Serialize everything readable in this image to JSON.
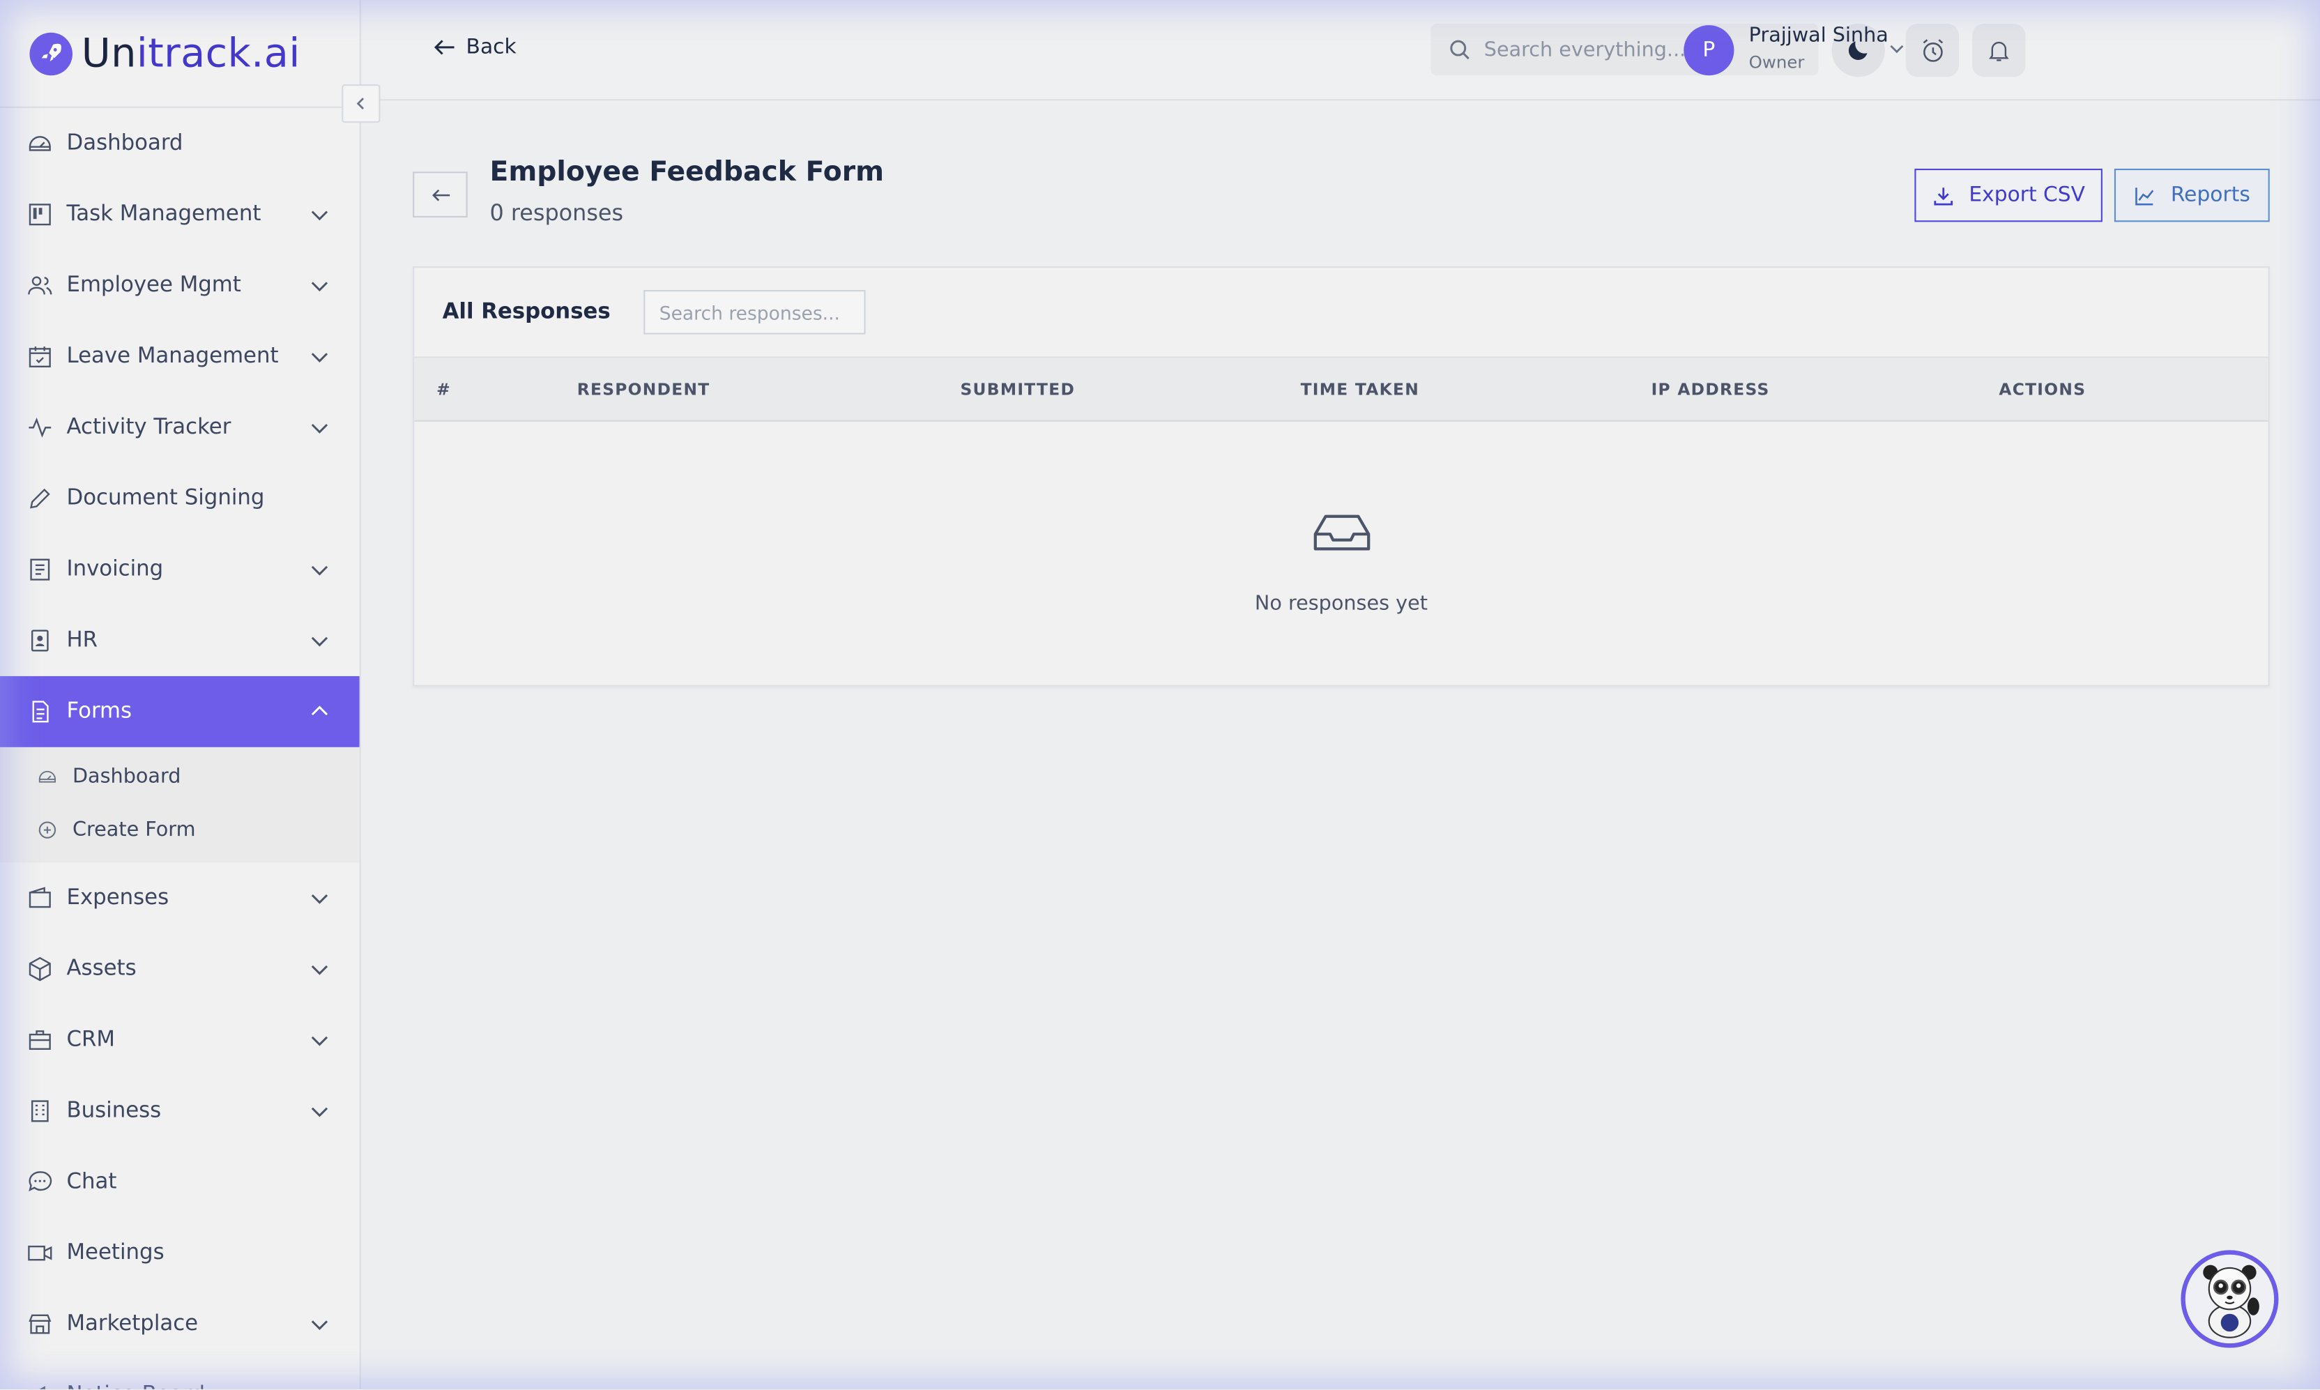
{
  "brand": {
    "logo_u": "Un",
    "logo_rest": "itrack.ai"
  },
  "sidebar": {
    "items": [
      {
        "label": "Dashboard",
        "icon": "gauge-icon",
        "has_chevron": false
      },
      {
        "label": "Task Management",
        "icon": "kanban-icon",
        "has_chevron": true
      },
      {
        "label": "Employee Mgmt",
        "icon": "users-icon",
        "has_chevron": true
      },
      {
        "label": "Leave Management",
        "icon": "calendar-check-icon",
        "has_chevron": true
      },
      {
        "label": "Activity Tracker",
        "icon": "activity-icon",
        "has_chevron": true
      },
      {
        "label": "Document Signing",
        "icon": "pen-icon",
        "has_chevron": false
      },
      {
        "label": "Invoicing",
        "icon": "receipt-icon",
        "has_chevron": true
      },
      {
        "label": "HR",
        "icon": "id-badge-icon",
        "has_chevron": true
      },
      {
        "label": "Forms",
        "icon": "document-icon",
        "has_chevron": true,
        "active": true
      },
      {
        "label": "Expenses",
        "icon": "wallet-icon",
        "has_chevron": true
      },
      {
        "label": "Assets",
        "icon": "cube-icon",
        "has_chevron": true
      },
      {
        "label": "CRM",
        "icon": "briefcase-icon",
        "has_chevron": true
      },
      {
        "label": "Business",
        "icon": "building-icon",
        "has_chevron": true
      },
      {
        "label": "Chat",
        "icon": "chat-icon",
        "has_chevron": false
      },
      {
        "label": "Meetings",
        "icon": "video-icon",
        "has_chevron": false
      },
      {
        "label": "Marketplace",
        "icon": "store-icon",
        "has_chevron": true
      },
      {
        "label": "Notice Board",
        "icon": "megaphone-icon",
        "has_chevron": false
      }
    ],
    "forms_sub": [
      {
        "label": "Dashboard",
        "icon": "gauge-icon"
      },
      {
        "label": "Create Form",
        "icon": "plus-circle-icon"
      }
    ]
  },
  "topbar": {
    "back_label": "Back",
    "search_placeholder": "Search everything...",
    "user": {
      "initial": "P",
      "name": "Prajjwal Sinha",
      "role": "Owner"
    }
  },
  "main": {
    "title": "Employee Feedback Form",
    "subtitle": "0 responses",
    "export_label": "Export CSV",
    "reports_label": "Reports",
    "card_title": "All Responses",
    "search_placeholder": "Search responses...",
    "columns": [
      "#",
      "RESPONDENT",
      "SUBMITTED",
      "TIME TAKEN",
      "IP ADDRESS",
      "ACTIONS"
    ],
    "empty_text": "No responses yet"
  },
  "colors": {
    "accent": "#6d5de8",
    "brand": "#4338ca"
  }
}
